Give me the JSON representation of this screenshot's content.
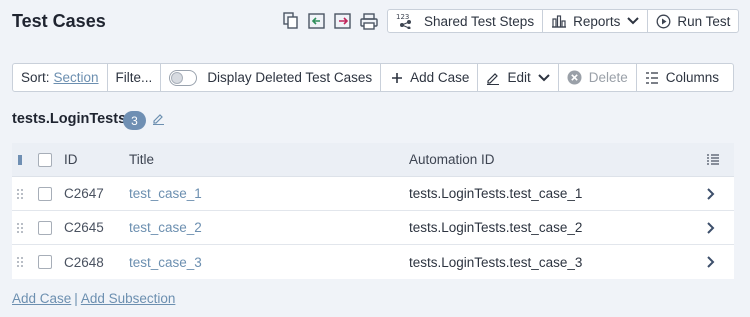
{
  "header": {
    "title": "Test Cases",
    "shared_steps_label": "Shared Test Steps",
    "shared_steps_icon_text": "123",
    "reports_label": "Reports",
    "run_test_label": "Run Test"
  },
  "toolbar": {
    "sort_label": "Sort:",
    "sort_value": "Section",
    "filter_label": "Filte...",
    "display_deleted_label": "Display Deleted Test Cases",
    "add_case_label": "Add Case",
    "edit_label": "Edit",
    "delete_label": "Delete",
    "columns_label": "Columns"
  },
  "section": {
    "title": "tests.LoginTests",
    "count": "3"
  },
  "table": {
    "columns": {
      "id": "ID",
      "title": "Title",
      "automation_id": "Automation ID"
    },
    "rows": [
      {
        "id": "C2647",
        "title": "test_case_1",
        "automation_id": "tests.LoginTests.test_case_1"
      },
      {
        "id": "C2645",
        "title": "test_case_2",
        "automation_id": "tests.LoginTests.test_case_2"
      },
      {
        "id": "C2648",
        "title": "test_case_3",
        "automation_id": "tests.LoginTests.test_case_3"
      }
    ]
  },
  "footer": {
    "add_case": "Add Case",
    "separator": "|",
    "add_subsection": "Add Subsection"
  },
  "colors": {
    "link": "#6c8fb0",
    "badge": "#6f8fb3",
    "background": "#f0f3f8",
    "export_accent": "#c0245a"
  }
}
